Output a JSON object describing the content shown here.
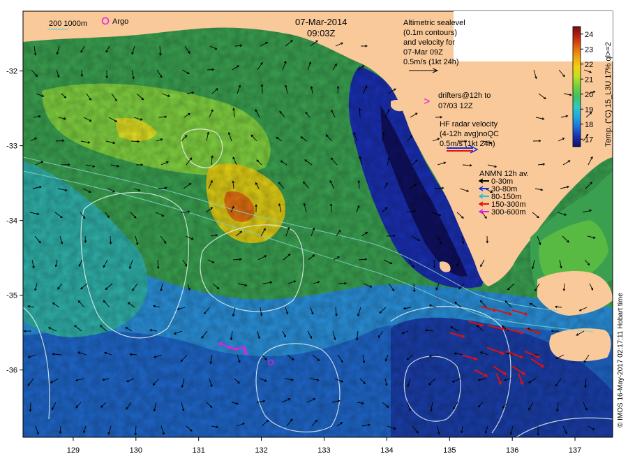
{
  "title": {
    "date": "07-Mar-2014",
    "time": "09:03Z"
  },
  "scale_bar": {
    "label": "200  1000m",
    "color": "#7fd0c8"
  },
  "argo": {
    "label": "Argo",
    "color": "#e020e0",
    "positions": [
      {
        "lon": 129.55,
        "lat": -31.4
      },
      {
        "lon": 132.15,
        "lat": -35.9
      }
    ]
  },
  "altimetry_note": [
    "Altimetric sealevel",
    "(0.1m contours)",
    "and velocity for",
    "07-Mar 09Z",
    "0.5m/s (1kt 24h)"
  ],
  "drifters_note": {
    "marker": ">",
    "lines": [
      "drifters@12h to",
      "07/03 12Z"
    ],
    "color": "#e020e0"
  },
  "hf_radar_note": [
    "HF radar velocity",
    "(4-12h avg)noQC",
    "0.5m/s (1kt 24h)"
  ],
  "anmn_legend": {
    "title": "ANMN 12h av.",
    "items": [
      {
        "label": "0-30m",
        "color": "#000000"
      },
      {
        "label": "30-80m",
        "color": "#1030e0"
      },
      {
        "label": "80-150m",
        "color": "#20c0d0"
      },
      {
        "label": "150-300m",
        "color": "#e01010"
      },
      {
        "label": "300-600m",
        "color": "#e020e0"
      }
    ]
  },
  "colorbar": {
    "label": "Temp. (°C) 15_L3U 17% ql>=2",
    "min": 16.5,
    "max": 24.5,
    "ticks": [
      17,
      18,
      19,
      20,
      21,
      22,
      23,
      24
    ],
    "stops": [
      "#101060",
      "#1a2fb0",
      "#1b73d8",
      "#20a8e0",
      "#30c8c0",
      "#40c060",
      "#70d040",
      "#c0e020",
      "#f0d010",
      "#f0a010",
      "#e06010",
      "#c02010",
      "#701010"
    ]
  },
  "credit": "© IMOS 16-May-2017 02:17:11 Hobart time",
  "chart_data": {
    "type": "map",
    "x_axis": {
      "ticks": [
        129,
        130,
        131,
        132,
        133,
        134,
        135,
        136,
        137
      ],
      "range": [
        128.2,
        137.6
      ]
    },
    "y_axis": {
      "ticks": [
        -32,
        -33,
        -34,
        -35,
        -36
      ],
      "range": [
        -36.9,
        -31.2
      ]
    },
    "land_color": "#f9c99a",
    "hf_radar_vectors": [
      {
        "lon": 135.5,
        "lat": -35.15,
        "u": 0.35,
        "v": -0.1
      },
      {
        "lon": 135.75,
        "lat": -35.2,
        "u": 0.35,
        "v": -0.1
      },
      {
        "lon": 136.0,
        "lat": -35.2,
        "u": 0.35,
        "v": -0.1
      },
      {
        "lon": 135.3,
        "lat": -35.35,
        "u": 0.35,
        "v": -0.1
      },
      {
        "lon": 135.6,
        "lat": -35.4,
        "u": 0.4,
        "v": -0.1
      },
      {
        "lon": 135.9,
        "lat": -35.45,
        "u": 0.4,
        "v": -0.1
      },
      {
        "lon": 136.2,
        "lat": -35.45,
        "u": 0.35,
        "v": -0.1
      },
      {
        "lon": 135.0,
        "lat": -35.5,
        "u": 0.35,
        "v": -0.1
      },
      {
        "lon": 135.6,
        "lat": -35.7,
        "u": 0.4,
        "v": -0.15
      },
      {
        "lon": 135.9,
        "lat": -35.75,
        "u": 0.4,
        "v": -0.15
      },
      {
        "lon": 136.2,
        "lat": -35.75,
        "u": 0.35,
        "v": -0.15
      },
      {
        "lon": 135.2,
        "lat": -35.8,
        "u": 0.35,
        "v": -0.1
      },
      {
        "lon": 135.7,
        "lat": -35.95,
        "u": 0.3,
        "v": -0.2
      },
      {
        "lon": 136.0,
        "lat": -35.95,
        "u": 0.3,
        "v": -0.2
      },
      {
        "lon": 136.3,
        "lat": -35.85,
        "u": 0.3,
        "v": -0.2
      },
      {
        "lon": 135.4,
        "lat": -36.0,
        "u": 0.3,
        "v": -0.15
      },
      {
        "lon": 136.1,
        "lat": -36.05,
        "u": 0.1,
        "v": -0.25
      },
      {
        "lon": 135.75,
        "lat": -36.05,
        "u": 0.1,
        "v": -0.25
      }
    ],
    "drifter_track": [
      {
        "lon": 131.35,
        "lat": -35.65
      },
      {
        "lon": 131.5,
        "lat": -35.7
      },
      {
        "lon": 131.6,
        "lat": -35.72
      },
      {
        "lon": 131.72,
        "lat": -35.7
      },
      {
        "lon": 131.75,
        "lat": -35.77
      }
    ]
  }
}
